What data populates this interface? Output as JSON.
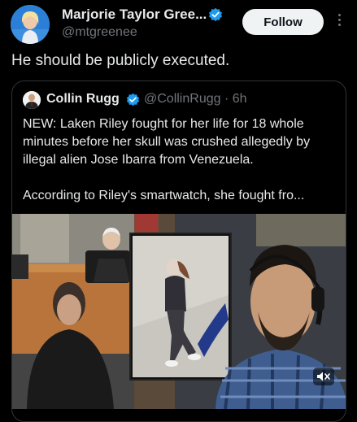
{
  "author": {
    "name": "Marjorie Taylor Gree...",
    "handle": "@mtgreenee",
    "verified": true
  },
  "follow_label": "Follow",
  "tweet": {
    "text": "He should be publicly executed."
  },
  "quoted": {
    "name": "Collin Rugg",
    "handle_time": "@CollinRugg · 6h",
    "verified": true,
    "paragraph1": "NEW: Laken Riley fought for her life for 18 whole minutes before her skull was crushed allegedly by illegal alien Jose Ibarra from Venezuela.",
    "paragraph2": "According to Riley's smartwatch, she fought fro..."
  },
  "colors": {
    "background": "#000000",
    "text": "#e7e9ea",
    "muted": "#71767b",
    "verified_blue": "#1d9bf0",
    "border": "#2f3336"
  },
  "icons": {
    "verified": "verified-badge-icon",
    "more": "more-options-icon",
    "mute": "muted-speaker-icon"
  }
}
